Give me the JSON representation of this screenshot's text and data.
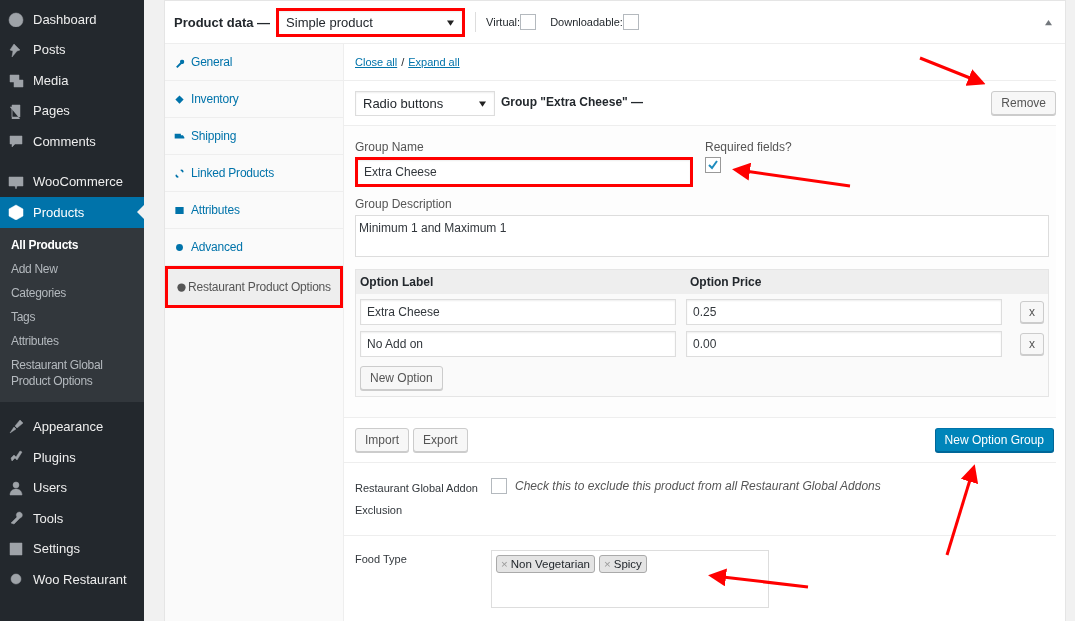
{
  "sidebar": {
    "items": [
      {
        "label": "Dashboard",
        "selected": false
      },
      {
        "label": "Posts",
        "selected": false
      },
      {
        "label": "Media",
        "selected": false
      },
      {
        "label": "Pages",
        "selected": false
      },
      {
        "label": "Comments",
        "selected": false
      },
      {
        "label": "WooCommerce",
        "selected": false
      },
      {
        "label": "Products",
        "selected": true,
        "children": [
          {
            "label": "All Products",
            "selected": true
          },
          {
            "label": "Add New",
            "selected": false
          },
          {
            "label": "Categories",
            "selected": false
          },
          {
            "label": "Tags",
            "selected": false
          },
          {
            "label": "Attributes",
            "selected": false
          },
          {
            "label": "Restaurant Global Product Options",
            "selected": false
          }
        ]
      },
      {
        "label": "Appearance",
        "selected": false
      },
      {
        "label": "Plugins",
        "selected": false
      },
      {
        "label": "Users",
        "selected": false
      },
      {
        "label": "Tools",
        "selected": false
      },
      {
        "label": "Settings",
        "selected": false
      },
      {
        "label": "Woo Restaurant",
        "selected": false
      }
    ]
  },
  "product_data": {
    "title": "Product data —",
    "product_type": {
      "value": "Simple product",
      "highlighted": true
    },
    "virtual": {
      "label": "Virtual:",
      "checked": false
    },
    "downloadable": {
      "label": "Downloadable:",
      "checked": false
    },
    "tabs": [
      {
        "label": "General",
        "selected": false,
        "highlighted": false
      },
      {
        "label": "Inventory",
        "selected": false,
        "highlighted": false
      },
      {
        "label": "Shipping",
        "selected": false,
        "highlighted": false
      },
      {
        "label": "Linked Products",
        "selected": false,
        "highlighted": false
      },
      {
        "label": "Attributes",
        "selected": false,
        "highlighted": false
      },
      {
        "label": "Advanced",
        "selected": false,
        "highlighted": false
      },
      {
        "label": "Restaurant Product Options",
        "selected": true,
        "highlighted": true
      }
    ]
  },
  "options_panel": {
    "links": [
      "Close all",
      "Expand all"
    ],
    "separator": "/",
    "group": {
      "type": "Radio buttons",
      "title": "Group \"Extra Cheese\" —",
      "remove_button": "Remove",
      "name_label": "Group Name",
      "name_value": "Extra Cheese",
      "name_highlighted": true,
      "required_label": "Required fields?",
      "required_checked": true,
      "description_label": "Group Description",
      "description_value": "Minimum 1 and Maximum 1",
      "columns": [
        "Option Label",
        "Option Price"
      ],
      "options": [
        {
          "label": "Extra Cheese",
          "price": "0.25",
          "delete": "x"
        },
        {
          "label": "No Add on",
          "price": "0.00",
          "delete": "x"
        }
      ],
      "new_option_button": "New Option"
    },
    "buttons": [
      "Import",
      "Export"
    ],
    "new_group_button": "New Option Group",
    "exclusion": {
      "label": "Restaurant Global Addon Exclusion",
      "checked": false,
      "text": "Check this to exclude this product from all Restaurant Global Addons"
    },
    "food_type": {
      "label": "Food Type",
      "tags": [
        {
          "label": "Non Vegetarian",
          "remove": "×"
        },
        {
          "label": "Spicy",
          "remove": "×"
        }
      ]
    }
  }
}
